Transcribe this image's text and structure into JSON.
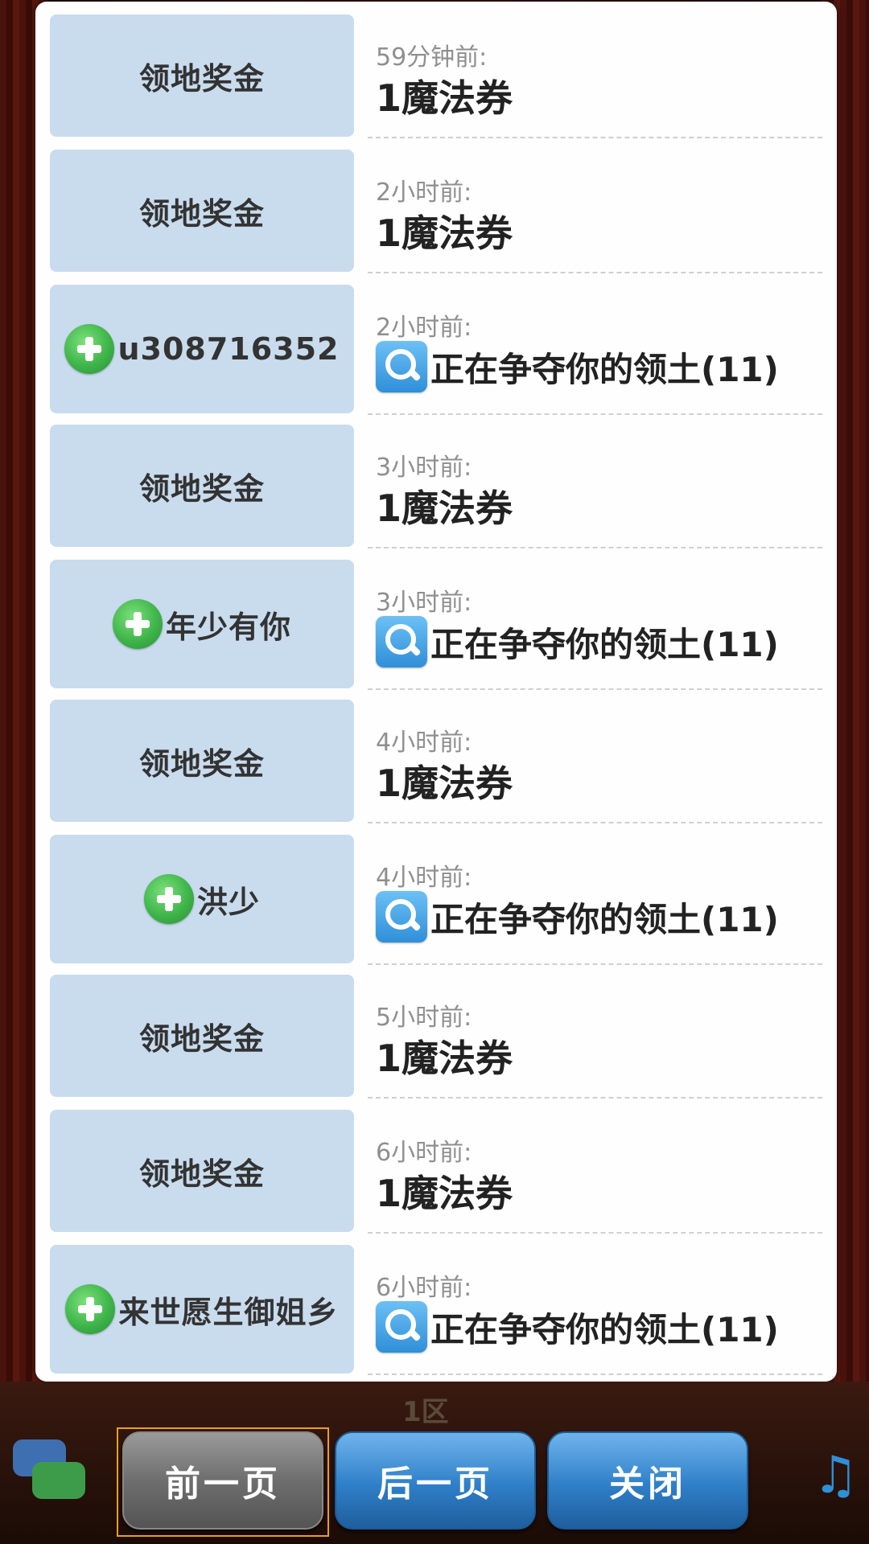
{
  "log": {
    "entries": [
      {
        "time": "59分钟前:",
        "sender": "领地奖金",
        "has_plus": false,
        "message": "1魔法券",
        "has_search": false
      },
      {
        "time": "2小时前:",
        "sender": "领地奖金",
        "has_plus": false,
        "message": "1魔法券",
        "has_search": false
      },
      {
        "time": "2小时前:",
        "sender": "u308716352",
        "has_plus": true,
        "message": "正在争夺你的领土(11)",
        "has_search": true
      },
      {
        "time": "3小时前:",
        "sender": "领地奖金",
        "has_plus": false,
        "message": "1魔法券",
        "has_search": false
      },
      {
        "time": "3小时前:",
        "sender": "年少有你",
        "has_plus": true,
        "message": "正在争夺你的领土(11)",
        "has_search": true
      },
      {
        "time": "4小时前:",
        "sender": "领地奖金",
        "has_plus": false,
        "message": "1魔法券",
        "has_search": false
      },
      {
        "time": "4小时前:",
        "sender": "洪少",
        "has_plus": true,
        "message": "正在争夺你的领土(11)",
        "has_search": true
      },
      {
        "time": "5小时前:",
        "sender": "领地奖金",
        "has_plus": false,
        "message": "1魔法券",
        "has_search": false
      },
      {
        "time": "6小时前:",
        "sender": "领地奖金",
        "has_plus": false,
        "message": "1魔法券",
        "has_search": false
      },
      {
        "time": "6小时前:",
        "sender": "来世愿生御姐乡",
        "has_plus": true,
        "message": "正在争夺你的领土(11)",
        "has_search": true
      }
    ]
  },
  "footer": {
    "zone_label": "1区",
    "prev_label": "前一页",
    "next_label": "后一页",
    "close_label": "关闭"
  },
  "colors": {
    "cell_bg": "#c9dcee",
    "button_blue": "#2f7fc8",
    "button_gray": "#6e6e6e",
    "plus_green": "#3fb54a"
  }
}
